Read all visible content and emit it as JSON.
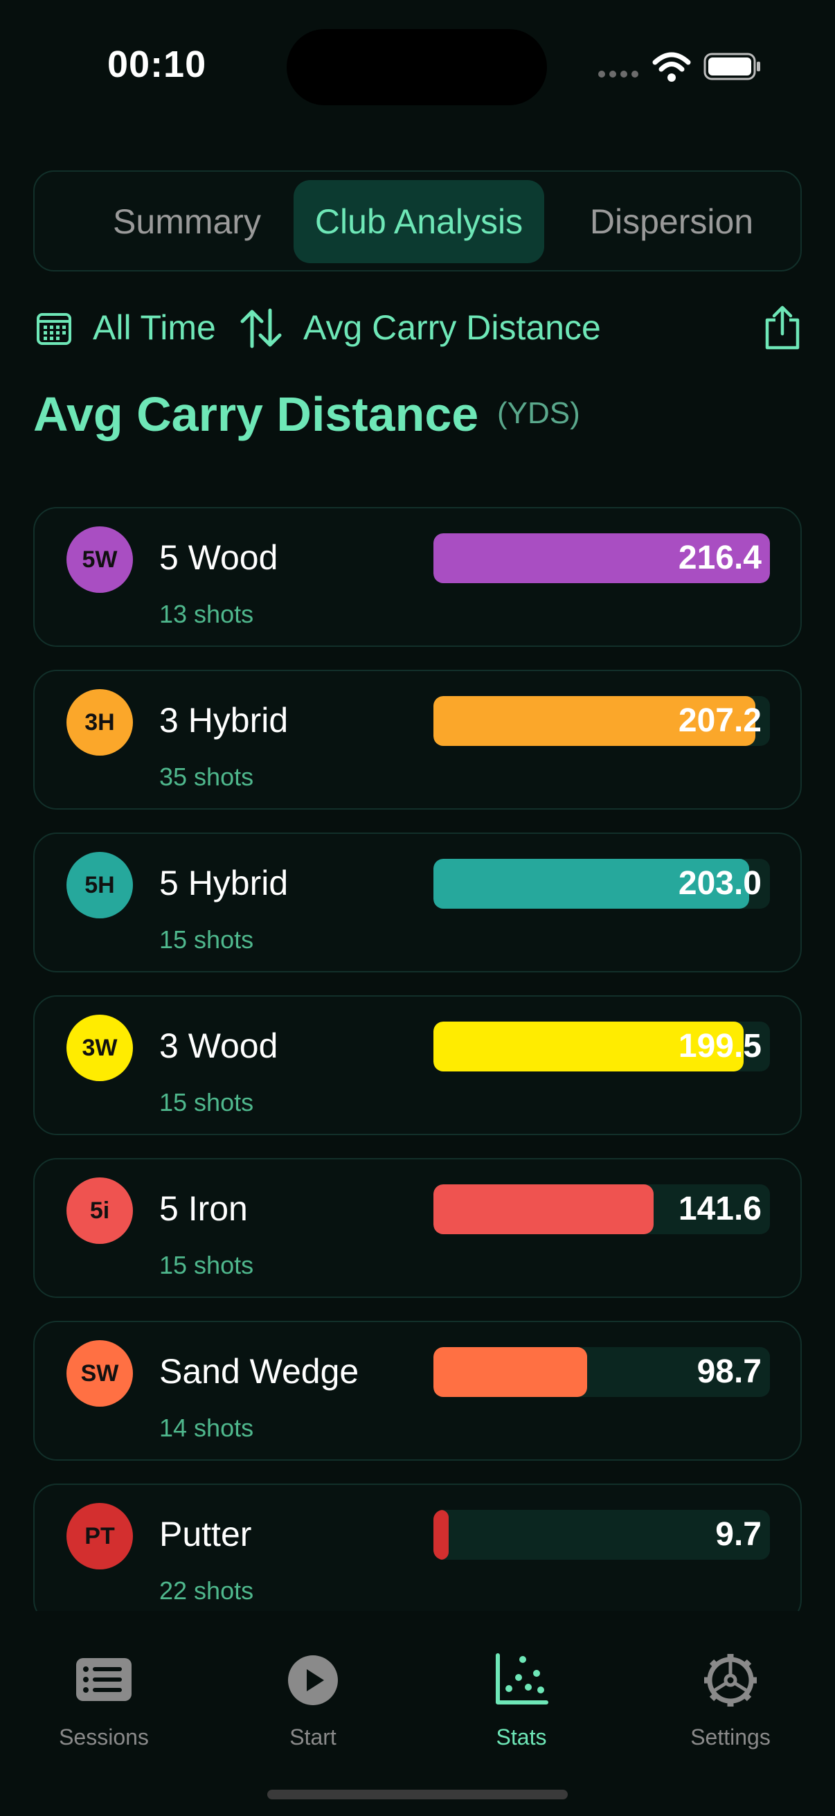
{
  "status": {
    "time": "00:10"
  },
  "segments": [
    {
      "label": "Summary",
      "selected": false
    },
    {
      "label": "Club Analysis",
      "selected": true
    },
    {
      "label": "Dispersion",
      "selected": false
    }
  ],
  "filters": {
    "time_range": "All Time",
    "sort_metric": "Avg Carry Distance"
  },
  "heading": {
    "title": "Avg Carry Distance",
    "unit": "(YDS)"
  },
  "clubs": [
    {
      "badge": "5W",
      "name": "5 Wood",
      "shots": "13 shots",
      "value": "216.4",
      "fraction": 1.0,
      "color": "#a94ec2"
    },
    {
      "badge": "3H",
      "name": "3 Hybrid",
      "shots": "35 shots",
      "value": "207.2",
      "fraction": 0.957,
      "color": "#fba72a"
    },
    {
      "badge": "5H",
      "name": "5 Hybrid",
      "shots": "15 shots",
      "value": "203.0",
      "fraction": 0.938,
      "color": "#26a89c"
    },
    {
      "badge": "3W",
      "name": "3 Wood",
      "shots": "15 shots",
      "value": "199.5",
      "fraction": 0.922,
      "color": "#ffec00"
    },
    {
      "badge": "5i",
      "name": "5 Iron",
      "shots": "15 shots",
      "value": "141.6",
      "fraction": 0.654,
      "color": "#ef5350"
    },
    {
      "badge": "SW",
      "name": "Sand Wedge",
      "shots": "14 shots",
      "value": "98.7",
      "fraction": 0.456,
      "color": "#ff7043"
    },
    {
      "badge": "PT",
      "name": "Putter",
      "shots": "22 shots",
      "value": "9.7",
      "fraction": 0.045,
      "color": "#d32f2f"
    }
  ],
  "tabbar": {
    "items": [
      {
        "label": "Sessions",
        "icon": "list-icon",
        "active": false
      },
      {
        "label": "Start",
        "icon": "play-icon",
        "active": false
      },
      {
        "label": "Stats",
        "icon": "chart-icon",
        "active": true
      },
      {
        "label": "Settings",
        "icon": "gear-icon",
        "active": false
      }
    ]
  },
  "colors": {
    "accent": "#6ee7b7",
    "background": "#060f0d",
    "card_border": "#12302a"
  }
}
